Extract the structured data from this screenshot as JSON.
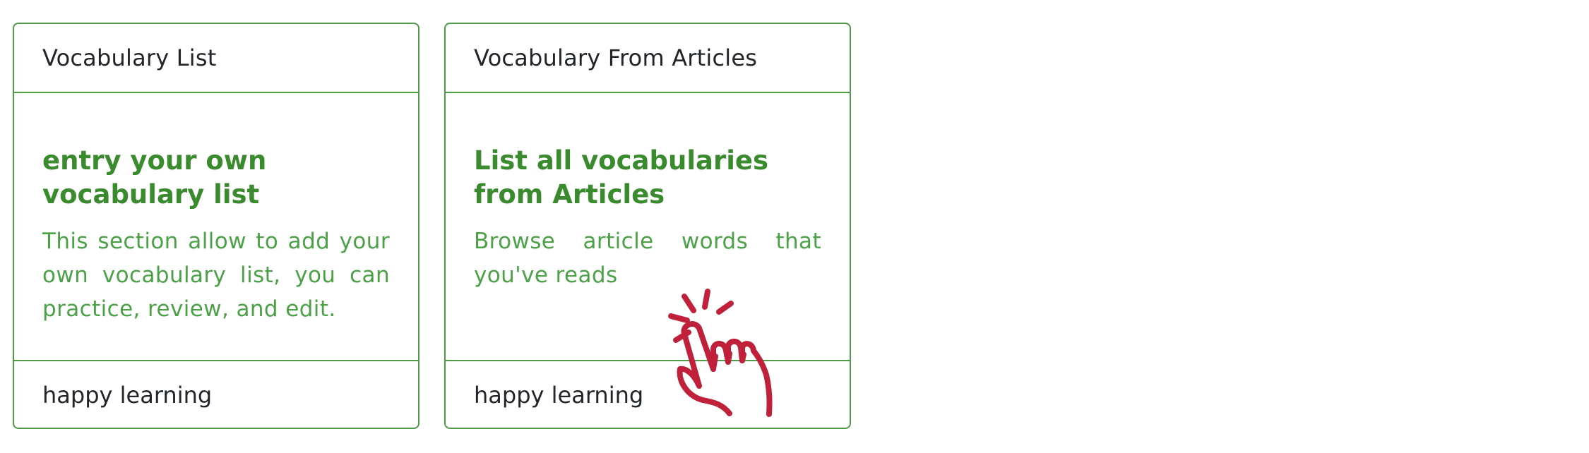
{
  "cards": [
    {
      "header": "Vocabulary List",
      "title": "entry your own vocabulary list",
      "text": "This section allow to add your own vocabulary list, you can practice, review, and edit.",
      "footer": "happy learning"
    },
    {
      "header": "Vocabulary From Articles",
      "title": "List all vocabularies from Articles",
      "text": "Browse article words that you've reads",
      "footer": "happy learning"
    }
  ],
  "icons": {
    "pointer": "hand-pointer-click-icon"
  },
  "colors": {
    "border": "#4e9a47",
    "title": "#3a8a2e",
    "text": "#4ba246",
    "pointer": "#c0203a"
  }
}
